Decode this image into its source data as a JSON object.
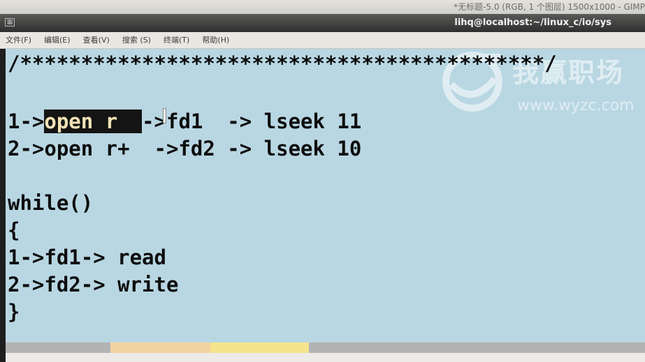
{
  "gimp_window": {
    "title": "*无标题-5.0 (RGB, 1 个图层) 1500x1000 - GIMP"
  },
  "terminal_window": {
    "title": "lihq@localhost:~/linux_c/io/sys",
    "icon": "terminal-window-icon"
  },
  "menu": {
    "items": [
      {
        "label": "文件(F)"
      },
      {
        "label": "编辑(E)"
      },
      {
        "label": "查看(V)"
      },
      {
        "label": "搜索 (S)"
      },
      {
        "label": "终端(T)"
      },
      {
        "label": "帮助(H)"
      }
    ]
  },
  "watermark": {
    "brand": "我赢职场",
    "url": "www.wyzc.com"
  },
  "code": {
    "comment_line": "/*******************************************/",
    "line1_selected": "open r  ",
    "line1_prefix": "1->",
    "line1_rest": "->fd1  -> lseek 11",
    "line2": "2->open r+  ->fd2 -> lseek 10",
    "line3": "while()",
    "line4": "{",
    "line5": "1->fd1-> read",
    "line6": "2->fd2-> write",
    "line7": "}"
  },
  "colors": {
    "terminal_bg": "#b9d7e3",
    "selection_bg": "#141414",
    "selection_fg": "#f3e2b6",
    "titlebar_bg": "#2e2e2e"
  }
}
